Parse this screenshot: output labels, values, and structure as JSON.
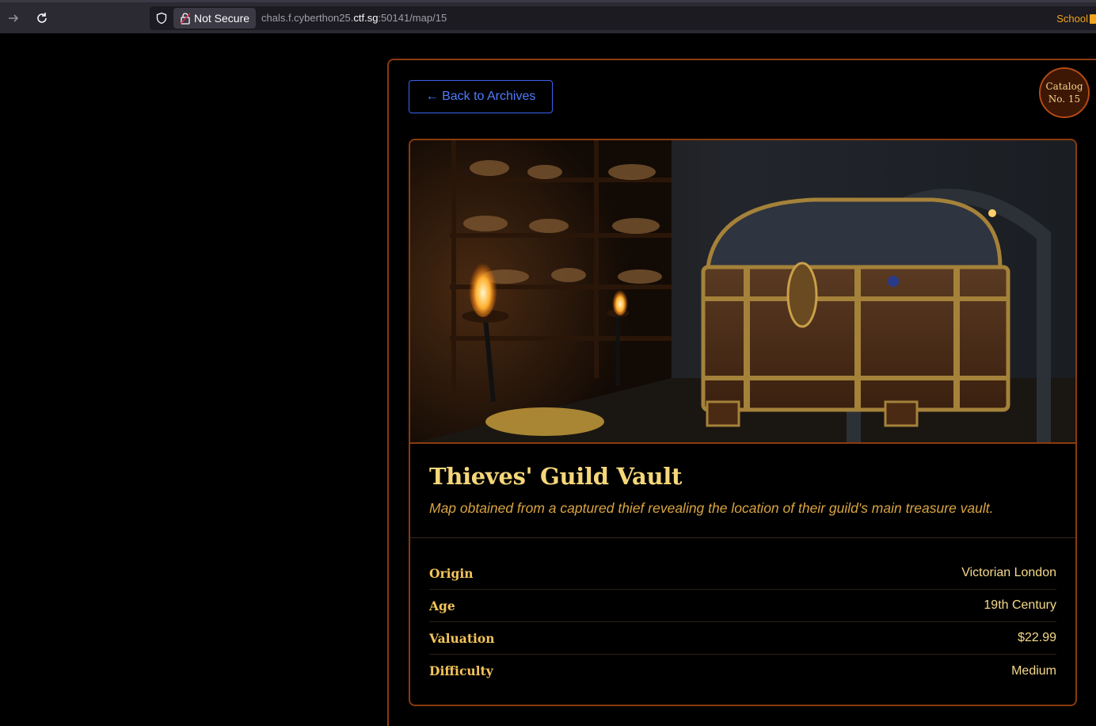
{
  "browser": {
    "security_label": "Not Secure",
    "url_prefix": "chals.f.cyberthon25.",
    "url_domain": "ctf.sg",
    "url_suffix": ":50141/map/15",
    "bookmark_label": "School"
  },
  "page": {
    "back_label": "← Back to Archives",
    "catalog_line1": "Catalog",
    "catalog_line2": "No. 15",
    "title": "Thieves' Guild Vault",
    "description": "Map obtained from a captured thief revealing the location of their guild's main treasure vault.",
    "details": [
      {
        "key": "Origin",
        "value": "Victorian London"
      },
      {
        "key": "Age",
        "value": "19th Century"
      },
      {
        "key": "Valuation",
        "value": "$22.99"
      },
      {
        "key": "Difficulty",
        "value": "Medium"
      }
    ]
  },
  "colors": {
    "accent_border": "#8b3a0e",
    "title_gold": "#f5d77a",
    "link_blue": "#4f7cff"
  }
}
